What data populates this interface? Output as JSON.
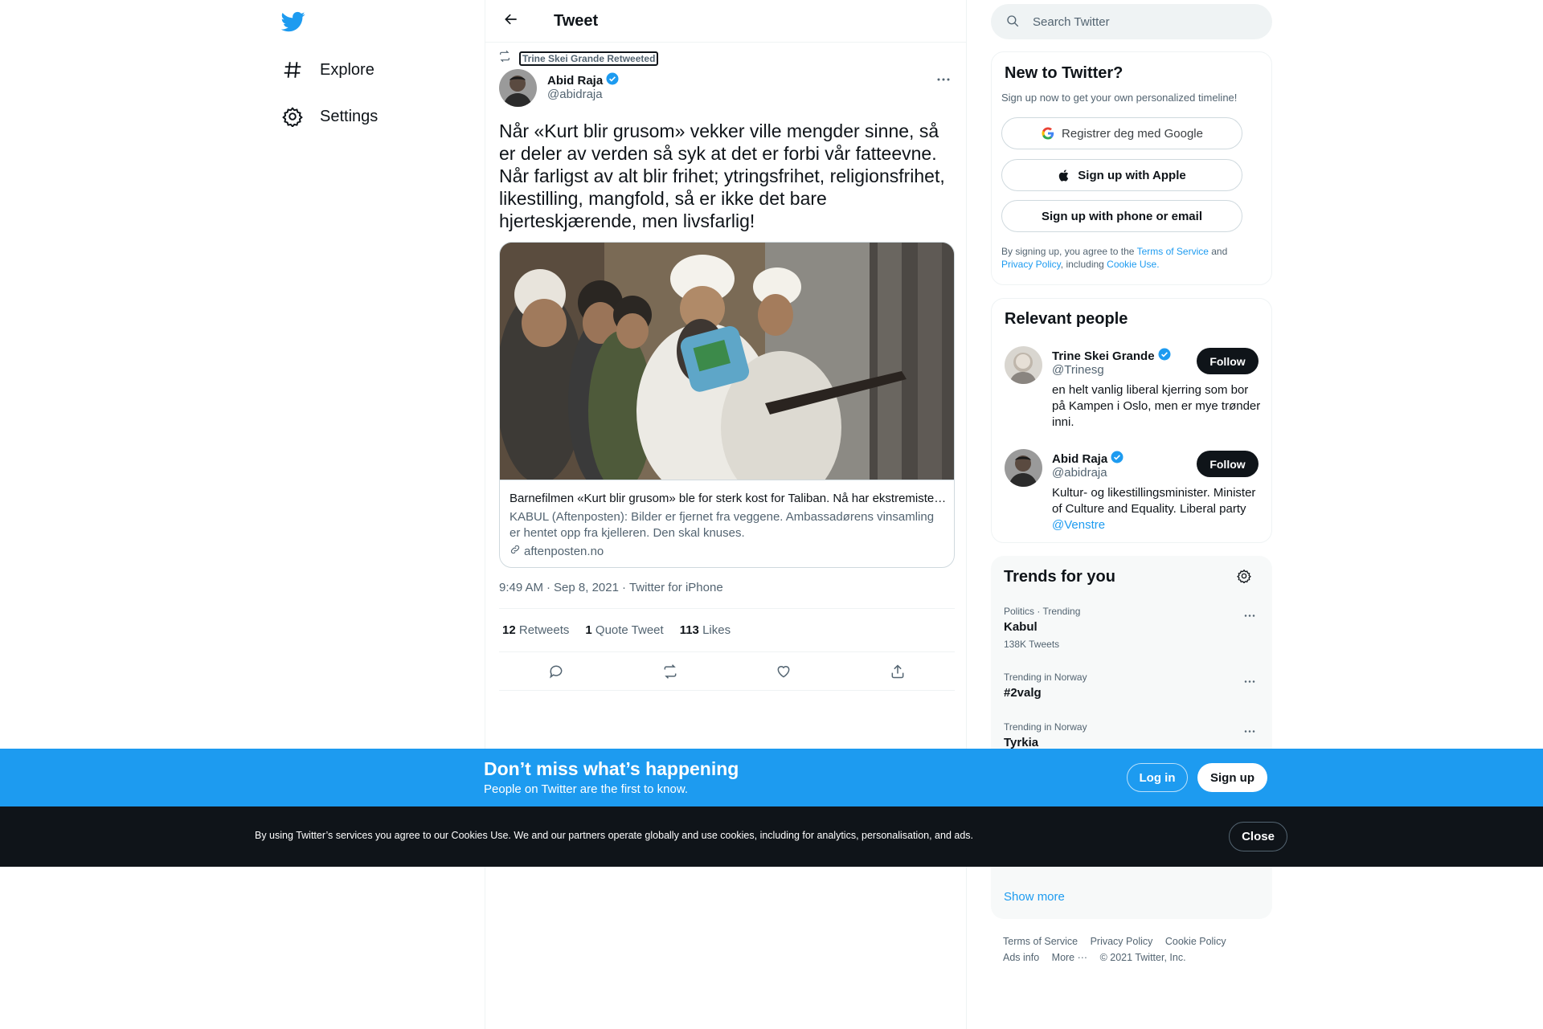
{
  "nav": {
    "logo_icon": "twitter-bird-icon",
    "brand_color": "#1d9bf0",
    "items": [
      {
        "label": "Explore",
        "icon": "hashtag-icon"
      },
      {
        "label": "Settings",
        "icon": "gear-icon"
      }
    ]
  },
  "header": {
    "back_icon": "arrow-left-icon",
    "title": "Tweet"
  },
  "tweet": {
    "retweeted_by": "Trine Skei Grande Retweeted",
    "author_name": "Abid Raja",
    "author_handle": "@abidraja",
    "verified": true,
    "text": "Når «Kurt blir grusom» vekker ville mengder sinne, så er deler av verden så syk at det er forbi vår fatteevne. Når farligst av alt blir frihet; ytringsfrihet, religionsfrihet, likestilling, mangfold, så er ikke det bare hjerteskjærende, men livsfarlig!",
    "card": {
      "title": "Barnefilmen «Kurt blir grusom» ble for sterk kost for Taliban. Nå har ekstremistene sl",
      "description": "KABUL (Aftenposten): Bilder er fjernet fra veggene. Ambassadørens vinsamling er hentet opp fra kjelleren. Den skal knuses.",
      "domain": "aftenposten.no"
    },
    "time": "9:49 AM",
    "date": "Sep 8, 2021",
    "source": "Twitter for iPhone",
    "separator": "·",
    "stats": {
      "retweets_count": "12",
      "retweets_label": "Retweets",
      "quotes_count": "1",
      "quotes_label": "Quote Tweet",
      "likes_count": "113",
      "likes_label": "Likes"
    }
  },
  "search": {
    "placeholder": "Search Twitter"
  },
  "new_to_twitter": {
    "title": "New to Twitter?",
    "subtitle": "Sign up now to get your own personalized timeline!",
    "google_label": "Registrer deg med Google",
    "apple_label": "Sign up with Apple",
    "phone_label": "Sign up with phone or email",
    "terms_prefix": "By signing up, you agree to the ",
    "terms_link": "Terms of Service",
    "terms_and": " and ",
    "privacy_link": "Privacy Policy",
    "including": ", including ",
    "cookie_link": "Cookie Use."
  },
  "relevant_people": {
    "title": "Relevant people",
    "follow_label": "Follow",
    "people": [
      {
        "name": "Trine Skei Grande",
        "handle": "@Trinesg",
        "bio": "en helt vanlig liberal kjerring som bor på Kampen i Oslo, men er mye trønder inni."
      },
      {
        "name": "Abid Raja",
        "handle": "@abidraja",
        "bio": "Kultur- og likestillingsminister. Minister of Culture and Equality. Liberal party ",
        "bio_link": "@Venstre"
      }
    ]
  },
  "trends": {
    "title": "Trends for you",
    "items": [
      {
        "context": "Politics · Trending",
        "name": "Kabul",
        "count": "138K Tweets"
      },
      {
        "context": "Trending in Norway",
        "name": "#2valg",
        "count": ""
      },
      {
        "context": "Trending in Norway",
        "name": "Tyrkia",
        "count": ""
      }
    ],
    "show_more": "Show more"
  },
  "footer": {
    "links": [
      "Terms of Service",
      "Privacy Policy",
      "Cookie Policy",
      "Ads info",
      "More ···"
    ],
    "copyright": "© 2021 Twitter, Inc."
  },
  "banner": {
    "title": "Don’t miss what’s happening",
    "subtitle": "People on Twitter are the first to know.",
    "login_label": "Log in",
    "signup_label": "Sign up"
  },
  "cookie_bar": {
    "text": "By using Twitter’s services you agree to our Cookies Use. We and our partners operate globally and use cookies, including for analytics, personalisation, and ads.",
    "close_label": "Close"
  }
}
